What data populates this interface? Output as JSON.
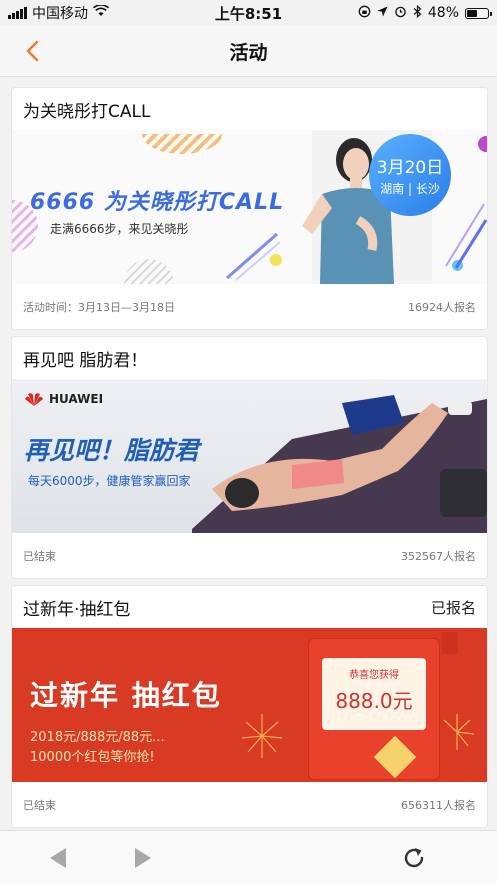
{
  "status_bar": {
    "carrier": "中国移动",
    "time": "上午8:51",
    "battery_percent": "48%",
    "battery_level": 0.48
  },
  "nav": {
    "title": "活动",
    "back_icon": "chevron-left-icon",
    "accent_color": "#f07a2a"
  },
  "activities": [
    {
      "title": "为关晓彤打CALL",
      "badge": "",
      "banner": {
        "headline": "6666 为关晓彤打CALL",
        "subline": "走满6666步，来见关晓彤",
        "date": "3月20日",
        "place": "湖南 | 长沙"
      },
      "footer_left": "活动时间：3月13日—3月18日",
      "footer_right": "16924人报名"
    },
    {
      "title": "再见吧 脂肪君！",
      "badge": "",
      "banner": {
        "brand": "HUAWEI",
        "headline": "再见吧！脂肪君",
        "subline": "每天6000步，健康管家赢回家"
      },
      "footer_left": "已结束",
      "footer_right": "352567人报名"
    },
    {
      "title": "过新年·抽红包",
      "badge": "已报名",
      "banner": {
        "headline": "过新年 抽红包",
        "subline1": "2018元/888元/88元...",
        "subline2": "10000个红包等你抢!",
        "envelope_label": "恭喜您获得",
        "envelope_amount": "888.0元"
      },
      "footer_left": "已结束",
      "footer_right": "656311人报名"
    }
  ],
  "bottom_bar": {
    "back_icon": "triangle-left-icon",
    "forward_icon": "triangle-right-icon",
    "refresh_icon": "refresh-icon"
  }
}
